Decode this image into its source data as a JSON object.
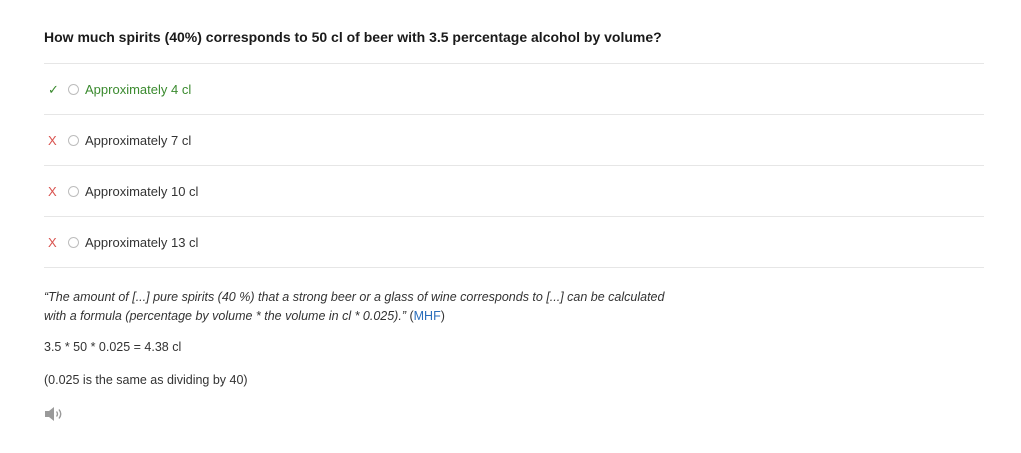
{
  "question": "How much spirits (40%) corresponds to 50 cl of beer with 3.5 percentage alcohol by volume?",
  "options": [
    {
      "mark": "✓",
      "label": "Approximately 4 cl",
      "status": "correct"
    },
    {
      "mark": "X",
      "label": "Approximately 7 cl",
      "status": "wrong"
    },
    {
      "mark": "X",
      "label": "Approximately 10 cl",
      "status": "wrong"
    },
    {
      "mark": "X",
      "label": "Approximately 13 cl",
      "status": "wrong"
    }
  ],
  "explanation": {
    "quote": "“The amount of [...] pure spirits (40 %) that a strong beer or a glass of wine corresponds to [...] can be calculated with a formula (percentage by volume * the volume in cl * 0.025).”",
    "source": "MHF",
    "source_open": " (",
    "source_close": ")"
  },
  "calculation": "3.5 * 50 * 0.025 = 4.38 cl",
  "note": "(0.025 is the same as dividing by 40)",
  "audio_icon": "speaker-icon",
  "colors": {
    "correct": "#3a8a2e",
    "wrong": "#d9534f",
    "link": "#2a6ebb"
  }
}
